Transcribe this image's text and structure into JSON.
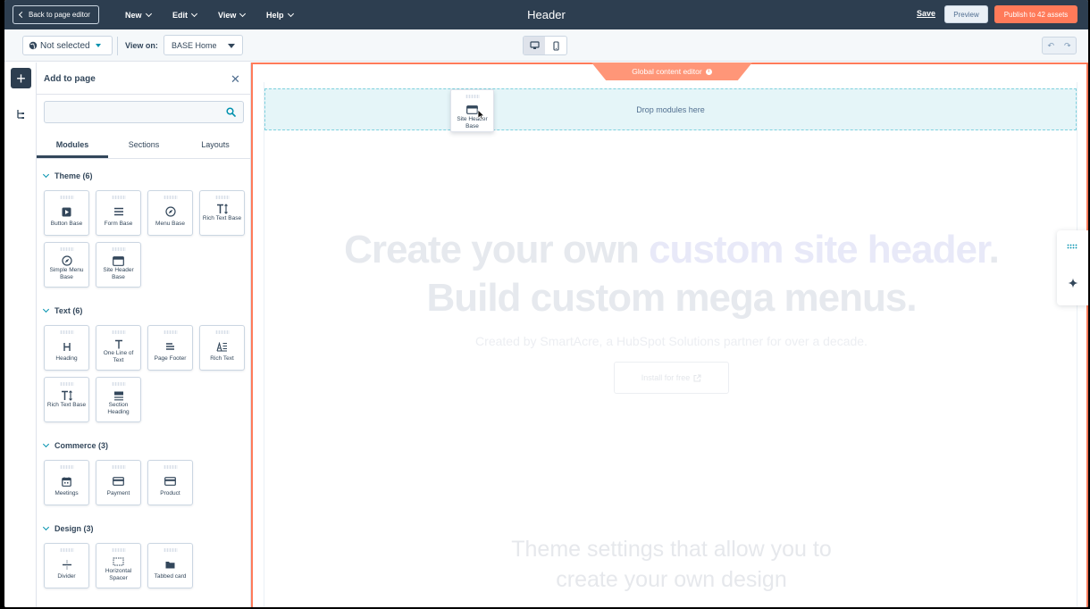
{
  "topbar": {
    "back_label": "Back to page editor",
    "menus": [
      {
        "label": "New"
      },
      {
        "label": "Edit"
      },
      {
        "label": "View"
      },
      {
        "label": "Help"
      }
    ],
    "title": "Header",
    "save_label": "Save",
    "preview_label": "Preview",
    "publish_label": "Publish to 42 assets"
  },
  "subbar": {
    "not_selected_label": "Not selected",
    "view_on_label": "View on:",
    "view_on_value": "BASE Home"
  },
  "panel": {
    "title": "Add to page",
    "search_placeholder": "",
    "tabs": [
      {
        "label": "Modules",
        "active": true
      },
      {
        "label": "Sections",
        "active": false
      },
      {
        "label": "Layouts",
        "active": false
      }
    ],
    "categories": [
      {
        "title": "Theme (6)",
        "modules": [
          {
            "label": "Button Base",
            "icon": "play-square-icon"
          },
          {
            "label": "Form Base",
            "icon": "form-lines-icon"
          },
          {
            "label": "Menu Base",
            "icon": "compass-icon"
          },
          {
            "label": "Rich Text Base",
            "icon": "rich-text-icon"
          },
          {
            "label": "Simple Menu Base",
            "icon": "compass-icon"
          },
          {
            "label": "Site Header Base",
            "icon": "window-icon"
          }
        ]
      },
      {
        "title": "Text (6)",
        "modules": [
          {
            "label": "Heading",
            "icon": "heading-icon"
          },
          {
            "label": "One Line of Text",
            "icon": "text-t-icon"
          },
          {
            "label": "Page Footer",
            "icon": "footer-icon"
          },
          {
            "label": "Rich Text",
            "icon": "rich-text-icon"
          },
          {
            "label": "Rich Text Base",
            "icon": "rich-text-icon"
          },
          {
            "label": "Section Heading",
            "icon": "section-heading-icon"
          }
        ]
      },
      {
        "title": "Commerce (3)",
        "modules": [
          {
            "label": "Meetings",
            "icon": "calendar-icon"
          },
          {
            "label": "Payment",
            "icon": "card-icon"
          },
          {
            "label": "Product",
            "icon": "card-icon"
          }
        ]
      },
      {
        "title": "Design (3)",
        "modules": [
          {
            "label": "Divider",
            "icon": "divider-icon"
          },
          {
            "label": "Horizontal Spacer",
            "icon": "spacer-icon"
          },
          {
            "label": "Tabbed card",
            "icon": "folder-icon"
          }
        ]
      }
    ]
  },
  "canvas": {
    "global_editor_label": "Global content editor",
    "dropzone_label": "Drop modules here",
    "dragged_module_label": "Site Header Base",
    "hero_line1_a": "Create your own ",
    "hero_line1_accent": "custom site header",
    "hero_line1_b": ".",
    "hero_line2": "Build custom mega menus.",
    "hero_sub": "Created by SmartAcre, a HubSpot Solutions partner for over a decade.",
    "install_label": "Install for free",
    "theme_line1": "Theme settings that allow you to",
    "theme_line2": "create your own design"
  },
  "colors": {
    "topbar_bg": "#2d3e50",
    "accent_orange": "#ff7a59",
    "teal_accent": "#0091ae"
  }
}
